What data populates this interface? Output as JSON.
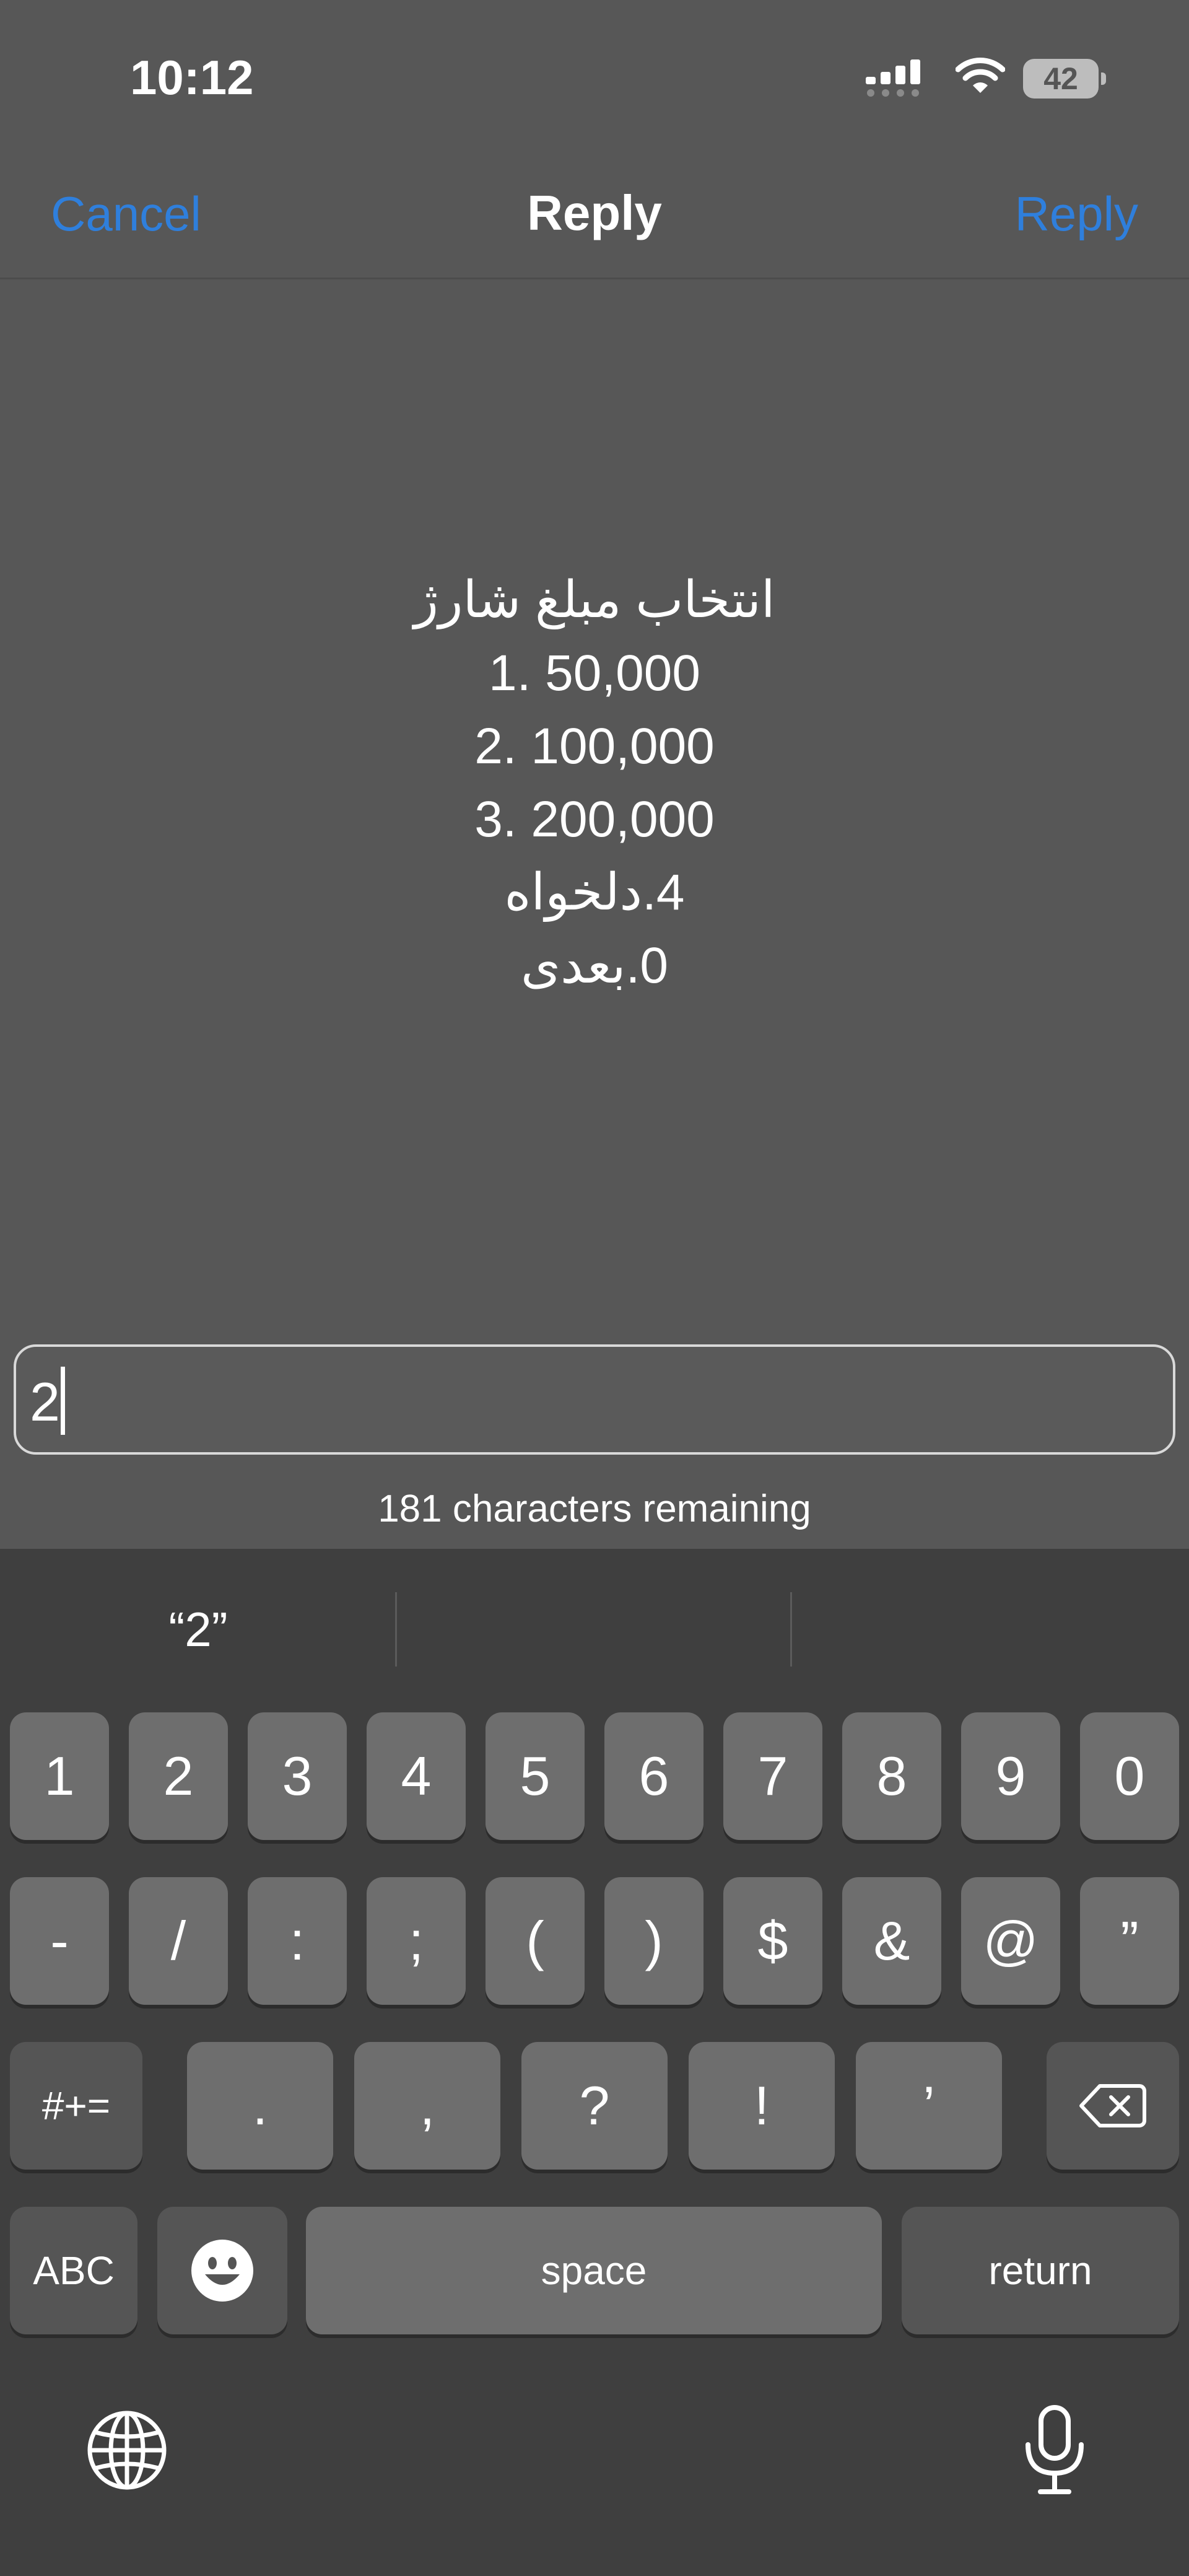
{
  "status_bar": {
    "time": "10:12",
    "battery": "42",
    "icons": [
      "signal-icon",
      "wifi-icon",
      "battery-icon"
    ]
  },
  "nav": {
    "cancel": "Cancel",
    "title": "Reply",
    "reply": "Reply"
  },
  "message": {
    "lines": [
      "انتخاب مبلغ شارژ",
      "1. 50,000",
      "2. 100,000",
      "3. 200,000",
      "4.دلخواه",
      "0.بعدی"
    ]
  },
  "reply_field": {
    "value": "2",
    "remaining": "181 characters remaining"
  },
  "keyboard": {
    "suggestion": "“2”",
    "row1": [
      "1",
      "2",
      "3",
      "4",
      "5",
      "6",
      "7",
      "8",
      "9",
      "0"
    ],
    "row2": [
      "-",
      "/",
      ":",
      ";",
      "(",
      ")",
      "$",
      "&",
      "@",
      "”"
    ],
    "row3": [
      ".",
      ",",
      "?",
      "!",
      "’"
    ],
    "toggle_symbols": "#+=",
    "abc": "ABC",
    "space": "space",
    "return": "return"
  },
  "colors": {
    "accent": "#2f7fdc",
    "background": "#575757",
    "keyboard_bg": "#3f3f3f",
    "key": "#6e6e6e",
    "key_dark": "#555555"
  }
}
